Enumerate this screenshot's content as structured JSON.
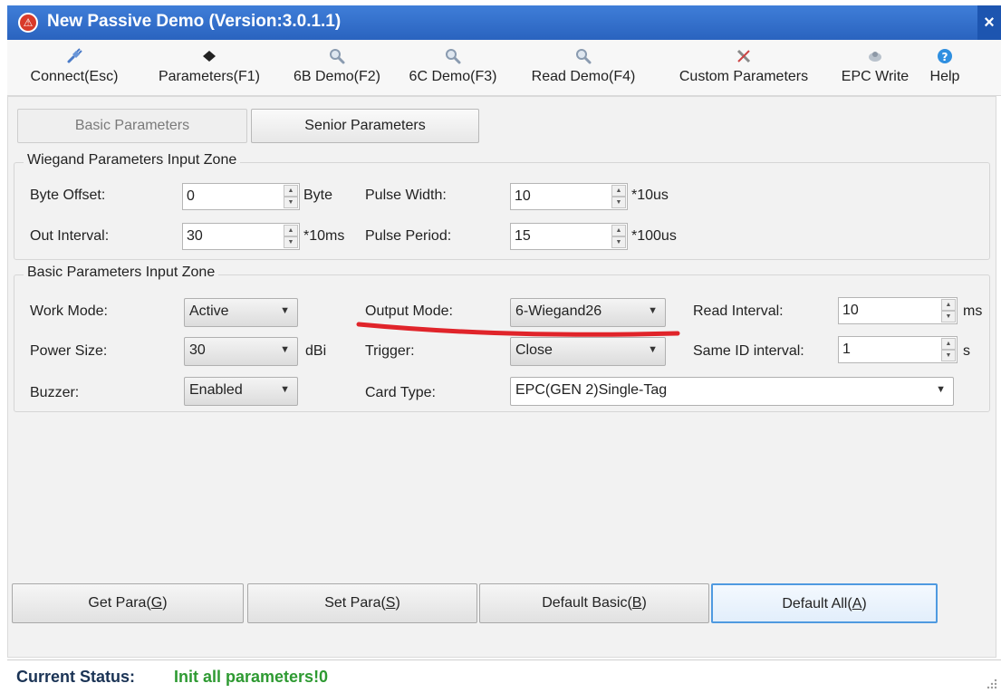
{
  "window": {
    "title": "New Passive Demo (Version:3.0.1.1)",
    "app_icon_glyph": "⚠",
    "close_glyph": "×"
  },
  "toolbar": {
    "items": [
      {
        "label": "Connect(Esc)",
        "icon": "plug-icon"
      },
      {
        "label": "Parameters(F1)",
        "icon": "chip-icon"
      },
      {
        "label": "6B Demo(F2)",
        "icon": "magnifier-icon"
      },
      {
        "label": "6C Demo(F3)",
        "icon": "magnifier-icon"
      },
      {
        "label": "Read Demo(F4)",
        "icon": "magnifier-icon"
      },
      {
        "label": "Custom Parameters",
        "icon": "tools-icon"
      },
      {
        "label": "EPC Write",
        "icon": "disc-icon"
      },
      {
        "label": "Help",
        "icon": "help-icon"
      }
    ]
  },
  "tabs": {
    "basic": "Basic Parameters",
    "senior": "Senior Parameters"
  },
  "wiegand": {
    "title": "Wiegand Parameters Input Zone",
    "byte_offset": {
      "label": "Byte Offset:",
      "value": "0",
      "unit": "Byte"
    },
    "pulse_width": {
      "label": "Pulse Width:",
      "value": "10",
      "unit": "*10us"
    },
    "out_interval": {
      "label": "Out Interval:",
      "value": "30",
      "unit": "*10ms"
    },
    "pulse_period": {
      "label": "Pulse Period:",
      "value": "15",
      "unit": "*100us"
    }
  },
  "basic": {
    "title": "Basic Parameters Input Zone",
    "work_mode": {
      "label": "Work Mode:",
      "value": "Active"
    },
    "output_mode": {
      "label": "Output Mode:",
      "value": "6-Wiegand26"
    },
    "read_interval": {
      "label": "Read Interval:",
      "value": "10",
      "unit": "ms"
    },
    "power_size": {
      "label": "Power Size:",
      "value": "30",
      "unit": "dBi"
    },
    "trigger": {
      "label": "Trigger:",
      "value": "Close"
    },
    "same_id_interval": {
      "label": "Same ID interval:",
      "value": "1",
      "unit": "s"
    },
    "buzzer": {
      "label": "Buzzer:",
      "value": "Enabled"
    },
    "card_type": {
      "label": "Card Type:",
      "value": "EPC(GEN 2)Single-Tag"
    }
  },
  "buttons": {
    "get_para": {
      "text": "Get Para(",
      "key": "G",
      "end": ")"
    },
    "set_para": {
      "text": "Set Para(",
      "key": "S",
      "end": ")"
    },
    "default_basic": {
      "text": "Default Basic(",
      "key": "B",
      "end": ")"
    },
    "default_all": {
      "text": "Default All(",
      "key": "A",
      "end": ")"
    }
  },
  "status": {
    "label": "Current Status:",
    "value": "Init all parameters!0"
  },
  "colors": {
    "title_bar": "#2a63bf",
    "status_value": "#2e9a32",
    "annotation_mark": "#e0242a",
    "focus_border": "#4f9ae0"
  }
}
